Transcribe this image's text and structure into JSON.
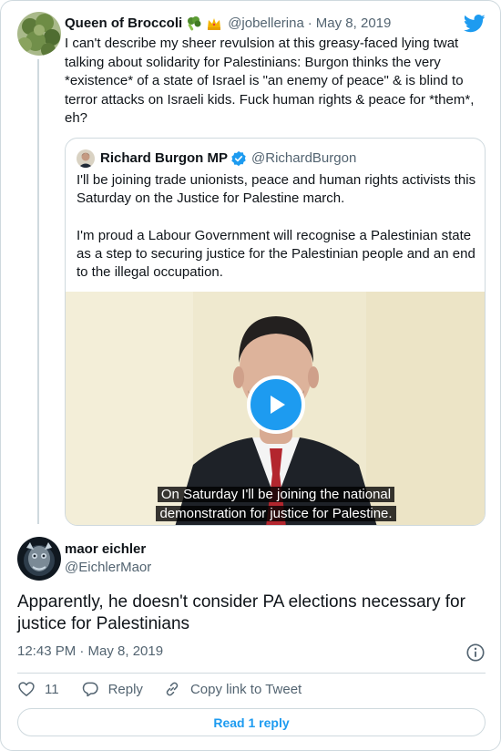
{
  "parent_tweet": {
    "author_name": "Queen of Broccoli",
    "handle": "@jobellerina",
    "separator": "·",
    "date": "May 8, 2019",
    "text": "I can't describe my sheer revulsion at this greasy-faced lying twat talking about solidarity for Palestinians: Burgon thinks the very *existence* of a state of Israel is \"an enemy of peace\" & is blind to terror attacks on Israeli kids. Fuck human rights & peace for *them*, eh?"
  },
  "quoted_tweet": {
    "author_name": "Richard Burgon MP",
    "handle": "@RichardBurgon",
    "paragraphs": [
      "I'll be joining trade unionists, peace and human rights activists this Saturday on the Justice for Palestine march.",
      "I'm proud a Labour Government will recognise a Palestinian state as a step to securing justice for the Palestinian people and an end to the illegal occupation."
    ],
    "video_captions": [
      "On Saturday I'll be joining the national",
      "demonstration for justice for Palestine."
    ]
  },
  "main_tweet": {
    "author_name": "maor eichler",
    "handle": "@EichlerMaor",
    "text": "Apparently, he doesn't consider PA elections necessary for justice for Palestinians",
    "timestamp": "12:43 PM · May 8, 2019",
    "like_count": "11",
    "reply_label": "Reply",
    "copy_link_label": "Copy link to Tweet",
    "read_reply_label": "Read 1 reply"
  },
  "colors": {
    "accent": "#1d9bf0",
    "text": "#0f1419",
    "muted": "#536471",
    "border": "#cfd9de"
  },
  "icons": [
    "twitter-bird-icon",
    "broccoli-emoji-icon",
    "crown-emoji-icon",
    "verified-badge-icon",
    "play-icon",
    "info-icon",
    "heart-icon",
    "reply-bubble-icon",
    "link-icon"
  ]
}
